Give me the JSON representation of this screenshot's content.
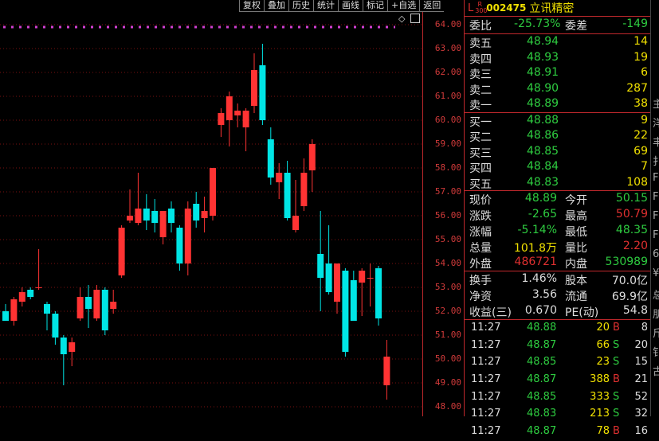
{
  "toolbar": [
    "复权",
    "叠加",
    "历史",
    "统计",
    "画线",
    "标记",
    "+自选",
    "返回"
  ],
  "axis": {
    "ticks": [
      "64.00",
      "63.00",
      "62.00",
      "61.00",
      "60.00",
      "59.00",
      "58.00",
      "57.00",
      "56.00",
      "55.00",
      "54.00",
      "53.00",
      "52.00",
      "51.00",
      "50.00",
      "49.00",
      "48.00"
    ]
  },
  "chart_data": {
    "type": "candlestick",
    "ylim": [
      48,
      64
    ],
    "colors": {
      "up": "#ff3333",
      "down": "#00e5e5",
      "dotted": "#d040d0",
      "grid": "#7a1010"
    },
    "candles": [
      {
        "o": 52.0,
        "h": 52.3,
        "l": 51.6,
        "c": 51.6
      },
      {
        "o": 51.6,
        "h": 52.6,
        "l": 51.4,
        "c": 52.5
      },
      {
        "o": 52.4,
        "h": 53.0,
        "l": 52.2,
        "c": 52.8
      },
      {
        "o": 52.9,
        "h": 53.0,
        "l": 52.5,
        "c": 52.6
      },
      {
        "o": 53.0,
        "h": 54.6,
        "l": 52.9,
        "c": 53.0
      },
      {
        "o": 52.3,
        "h": 52.4,
        "l": 51.2,
        "c": 51.9
      },
      {
        "o": 51.9,
        "h": 52.0,
        "l": 50.6,
        "c": 50.9
      },
      {
        "o": 50.9,
        "h": 51.0,
        "l": 48.9,
        "c": 50.2
      },
      {
        "o": 50.3,
        "h": 50.9,
        "l": 49.7,
        "c": 50.7
      },
      {
        "o": 51.7,
        "h": 53.0,
        "l": 51.6,
        "c": 52.6
      },
      {
        "o": 52.6,
        "h": 53.1,
        "l": 51.3,
        "c": 52.1
      },
      {
        "o": 51.7,
        "h": 53.1,
        "l": 51.6,
        "c": 52.9
      },
      {
        "o": 52.9,
        "h": 53.0,
        "l": 51.0,
        "c": 51.2
      },
      {
        "o": 52.1,
        "h": 52.9,
        "l": 51.9,
        "c": 52.4
      },
      {
        "o": 53.5,
        "h": 55.6,
        "l": 53.4,
        "c": 55.5
      },
      {
        "o": 55.8,
        "h": 57.1,
        "l": 55.7,
        "c": 56.0
      },
      {
        "o": 55.7,
        "h": 57.8,
        "l": 55.6,
        "c": 56.3
      },
      {
        "o": 56.3,
        "h": 56.9,
        "l": 55.4,
        "c": 55.8
      },
      {
        "o": 56.2,
        "h": 56.7,
        "l": 55.3,
        "c": 55.7
      },
      {
        "o": 55.1,
        "h": 56.2,
        "l": 54.8,
        "c": 56.2
      },
      {
        "o": 56.3,
        "h": 56.6,
        "l": 55.3,
        "c": 55.7
      },
      {
        "o": 55.5,
        "h": 55.6,
        "l": 53.7,
        "c": 54.0
      },
      {
        "o": 54.0,
        "h": 56.6,
        "l": 53.5,
        "c": 56.3
      },
      {
        "o": 56.5,
        "h": 57.0,
        "l": 55.5,
        "c": 55.8
      },
      {
        "o": 55.9,
        "h": 56.8,
        "l": 55.3,
        "c": 56.2
      },
      {
        "o": 56.0,
        "h": 57.4,
        "l": 55.8,
        "c": 58.0
      },
      {
        "o": 59.8,
        "h": 60.5,
        "l": 59.3,
        "c": 60.3
      },
      {
        "o": 60.0,
        "h": 61.2,
        "l": 58.9,
        "c": 61.0
      },
      {
        "o": 60.2,
        "h": 60.7,
        "l": 59.7,
        "c": 60.4
      },
      {
        "o": 59.7,
        "h": 60.5,
        "l": 58.7,
        "c": 60.4
      },
      {
        "o": 60.6,
        "h": 62.8,
        "l": 60.3,
        "c": 62.1
      },
      {
        "o": 62.3,
        "h": 63.2,
        "l": 59.8,
        "c": 60.0
      },
      {
        "o": 59.2,
        "h": 59.7,
        "l": 57.3,
        "c": 57.6
      },
      {
        "o": 57.4,
        "h": 58.2,
        "l": 56.7,
        "c": 57.8
      },
      {
        "o": 57.8,
        "h": 58.3,
        "l": 55.8,
        "c": 55.9
      },
      {
        "o": 55.4,
        "h": 57.5,
        "l": 55.3,
        "c": 56.0
      },
      {
        "o": 56.4,
        "h": 58.4,
        "l": 56.2,
        "c": 57.8
      },
      {
        "o": 57.9,
        "h": 59.2,
        "l": 57.0,
        "c": 59.0
      },
      {
        "o": 54.4,
        "h": 56.2,
        "l": 52.0,
        "c": 53.4
      },
      {
        "o": 54.0,
        "h": 55.6,
        "l": 52.7,
        "c": 52.8
      },
      {
        "o": 52.4,
        "h": 54.0,
        "l": 51.9,
        "c": 54.0
      },
      {
        "o": 53.7,
        "h": 53.8,
        "l": 50.1,
        "c": 50.3
      },
      {
        "o": 53.3,
        "h": 53.7,
        "l": 51.6,
        "c": 51.6
      },
      {
        "o": 53.2,
        "h": 53.8,
        "l": 51.8,
        "c": 53.7
      },
      {
        "o": 53.4,
        "h": 54.0,
        "l": 52.2,
        "c": 53.4
      },
      {
        "o": 53.8,
        "h": 53.9,
        "l": 51.4,
        "c": 51.7
      },
      {
        "o": 48.9,
        "h": 50.8,
        "l": 48.3,
        "c": 50.1
      }
    ]
  },
  "stock": {
    "l": "L",
    "r": "R",
    "r_sub": "300",
    "code": "002475",
    "name": "立讯精密"
  },
  "weibi": {
    "label": "委比",
    "value": "-25.73%",
    "label2": "委差",
    "value2": "-149"
  },
  "sell": [
    {
      "label": "卖五",
      "price": "48.94",
      "vol": "14"
    },
    {
      "label": "卖四",
      "price": "48.93",
      "vol": "19"
    },
    {
      "label": "卖三",
      "price": "48.91",
      "vol": "6"
    },
    {
      "label": "卖二",
      "price": "48.90",
      "vol": "287"
    },
    {
      "label": "卖一",
      "price": "48.89",
      "vol": "38"
    }
  ],
  "buy": [
    {
      "label": "买一",
      "price": "48.88",
      "vol": "9"
    },
    {
      "label": "买二",
      "price": "48.86",
      "vol": "22"
    },
    {
      "label": "买三",
      "price": "48.85",
      "vol": "69"
    },
    {
      "label": "买四",
      "price": "48.84",
      "vol": "7"
    },
    {
      "label": "买五",
      "price": "48.83",
      "vol": "108"
    }
  ],
  "quote": [
    {
      "l1": "现价",
      "v1": "48.89",
      "l2": "今开",
      "v2": "50.15"
    },
    {
      "l1": "涨跌",
      "v1": "-2.65",
      "l2": "最高",
      "v2": "50.79"
    },
    {
      "l1": "涨幅",
      "v1": "-5.14%",
      "l2": "最低",
      "v2": "48.35"
    },
    {
      "l1": "总量",
      "v1": "101.8万",
      "l2": "量比",
      "v2": "2.20"
    },
    {
      "l1": "外盘",
      "v1": "486721",
      "l2": "内盘",
      "v2": "530989"
    }
  ],
  "fin": [
    {
      "l1": "换手",
      "v1": "1.46%",
      "l2": "股本",
      "v2": "70.0亿"
    },
    {
      "l1": "净资",
      "v1": "3.56",
      "l2": "流通",
      "v2": "69.9亿"
    },
    {
      "l1": "收益(三)",
      "v1": "0.670",
      "l2": "PE(动)",
      "v2": "54.8"
    }
  ],
  "trades": [
    {
      "time": "11:27",
      "price": "48.88",
      "vol": "20",
      "bs": "B",
      "n": "8"
    },
    {
      "time": "11:27",
      "price": "48.87",
      "vol": "66",
      "bs": "S",
      "n": "20"
    },
    {
      "time": "11:27",
      "price": "48.85",
      "vol": "23",
      "bs": "S",
      "n": "15"
    },
    {
      "time": "11:27",
      "price": "48.87",
      "vol": "388",
      "bs": "B",
      "n": "21"
    },
    {
      "time": "11:27",
      "price": "48.85",
      "vol": "333",
      "bs": "S",
      "n": "52"
    },
    {
      "time": "11:27",
      "price": "48.83",
      "vol": "213",
      "bs": "S",
      "n": "32"
    },
    {
      "time": "11:27",
      "price": "48.87",
      "vol": "78",
      "bs": "B",
      "n": "16"
    }
  ],
  "edge_chars": [
    "主",
    "洋",
    "丰",
    "扌",
    "F",
    "F",
    "F",
    "F",
    "6",
    "¥",
    "总",
    "朋",
    "斤",
    "钅",
    "古"
  ]
}
